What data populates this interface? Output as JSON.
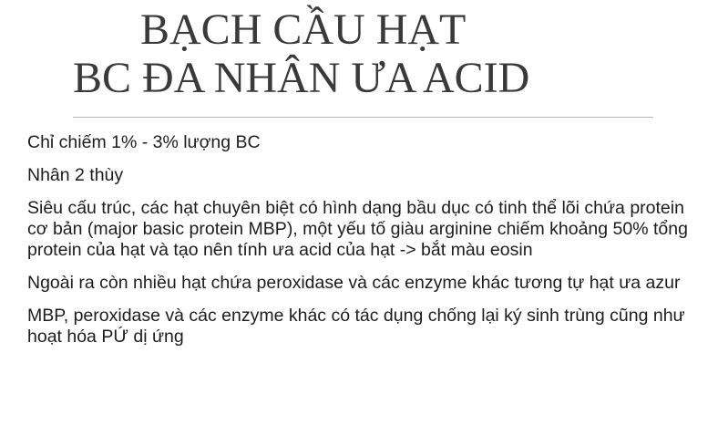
{
  "slide": {
    "title_line1": "BẠCH CẦU HẠT",
    "title_line2": "BC ĐA NHÂN ƯA ACID",
    "paragraphs": [
      "Chỉ chiếm 1% - 3% lượng BC",
      "Nhân 2 thùy",
      "Siêu cấu trúc, các hạt chuyên biệt có hình dạng bầu dục có tinh thể lõi chứa protein cơ bản (major basic protein MBP), một yếu tố giàu arginine chiếm khoảng 50% tổng protein của hạt và tạo nên tính ưa acid của hạt -> bắt màu eosin",
      "Ngoài ra còn nhiều hạt chứa peroxidase và các enzyme khác tương tự hạt ưa azur",
      "MBP, peroxidase và các enzyme khác có tác dụng chống lại ký sinh trùng cũng như hoạt hóa PỨ dị ứng"
    ]
  }
}
